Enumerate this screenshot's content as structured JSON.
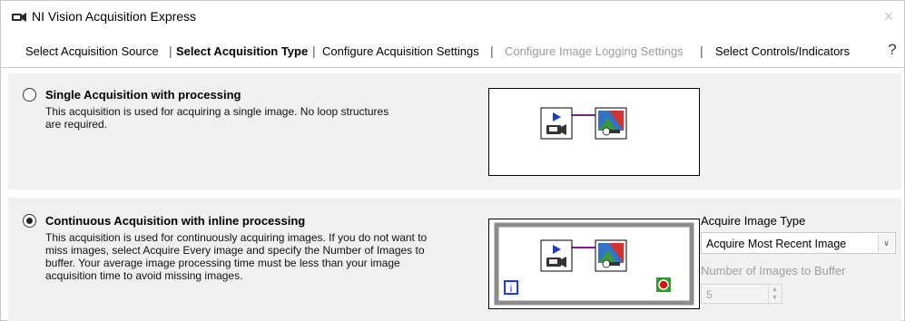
{
  "window": {
    "title": "NI Vision Acquisition Express"
  },
  "tabs": [
    {
      "label": "Select Acquisition Source",
      "state": "normal"
    },
    {
      "label": "Select Acquisition Type",
      "state": "active"
    },
    {
      "label": "Configure Acquisition Settings",
      "state": "normal"
    },
    {
      "label": "Configure Image Logging Settings",
      "state": "disabled"
    },
    {
      "label": "Select Controls/Indicators",
      "state": "normal"
    }
  ],
  "separator": "|",
  "help_glyph": "?",
  "close_glyph": "×",
  "options": [
    {
      "title": "Single Acquisition with processing",
      "description": "This acquisition is used for acquiring a single image. No loop structures are required.",
      "selected": false
    },
    {
      "title": "Continuous Acquisition with inline processing",
      "description": "This acquisition is used for continuously acquiring images.  If you do not want to miss images, select Acquire Every image and specify the Number of Images to buffer. Your average image processing time must be less than your image acquisition time to avoid missing images.",
      "selected": true
    }
  ],
  "acquire_image_type": {
    "label": "Acquire Image Type",
    "value": "Acquire Most Recent Image"
  },
  "images_to_buffer": {
    "label": "Number of Images to Buffer",
    "value": "5",
    "enabled": false
  },
  "loop": {
    "iteration_label": "i"
  },
  "colors": {
    "wire": "#7a1f8a",
    "loop_border": "#8c8c8c",
    "iteration_blue": "#1a3cff",
    "stop_red": "#e01010",
    "panel_bg": "#f0f0f0"
  },
  "icons": {
    "app": "camera-icon",
    "acquire": "acquire-camera-icon",
    "process": "image-processing-icon",
    "stop": "loop-stop-icon"
  }
}
